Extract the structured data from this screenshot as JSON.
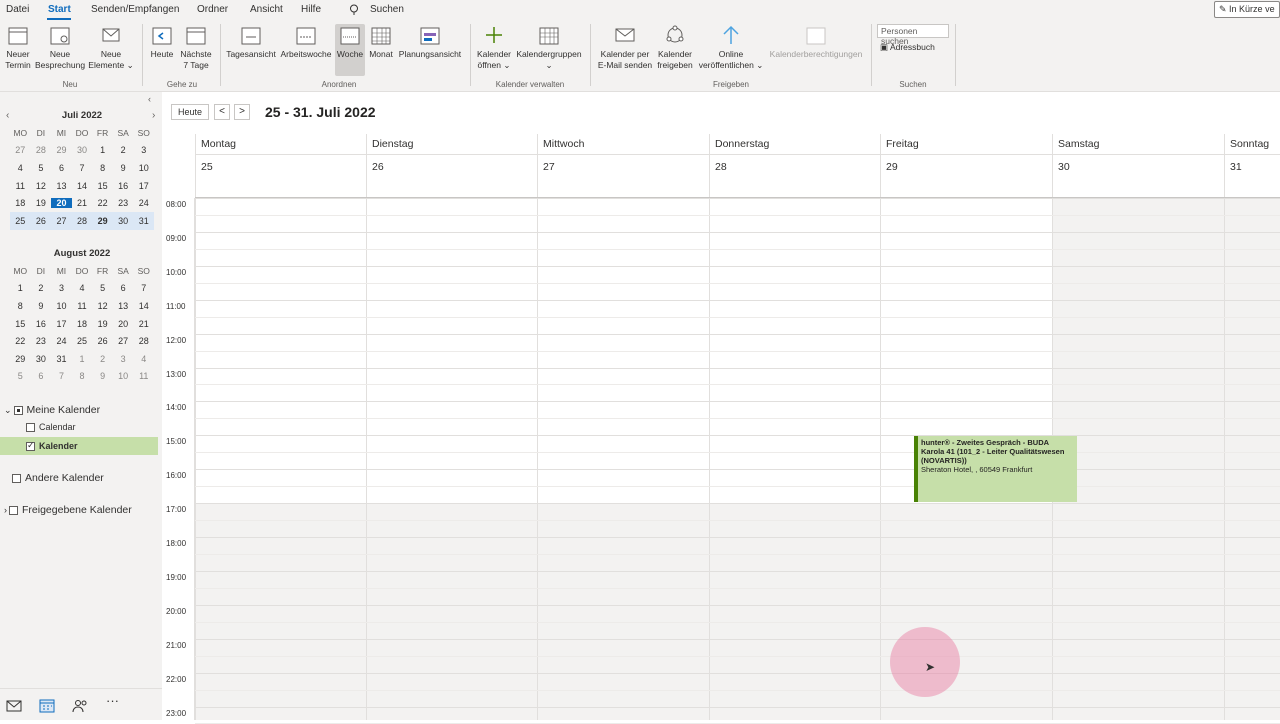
{
  "menu": {
    "items": [
      "Datei",
      "Start",
      "Senden/Empfangen",
      "Ordner",
      "Ansicht",
      "Hilfe",
      "Suchen"
    ],
    "soon_label": "In Kürze ve"
  },
  "ribbon": {
    "neu": {
      "termin": "Neuer Termin",
      "besprechung": "Neue Besprechung",
      "elemente": "Neue Elemente",
      "group": "Neu"
    },
    "gehezu": {
      "heute": "Heute",
      "naechste": "Nächste 7 Tage",
      "group": "Gehe zu"
    },
    "anordnen": {
      "tagesansicht": "Tagesansicht",
      "arbeitswoche": "Arbeitswoche",
      "woche": "Woche",
      "monat": "Monat",
      "planungsansicht": "Planungsansicht",
      "group": "Anordnen"
    },
    "verwalten": {
      "oeffnen": "Kalender öffnen",
      "gruppen": "Kalendergruppen",
      "group": "Kalender verwalten"
    },
    "freigeben": {
      "email": "Kalender per E-Mail senden",
      "freigeben": "Kalender freigeben",
      "online": "Online veröffentlichen",
      "berechtigungen": "Kalenderberechtigungen",
      "group": "Freigeben"
    },
    "suchen": {
      "placeholder": "Personen suchen",
      "adressbuch": "Adressbuch",
      "group": "Suchen"
    }
  },
  "mini_calendars": [
    {
      "title": "Juli 2022",
      "weekdays": [
        "MO",
        "DI",
        "MI",
        "DO",
        "FR",
        "SA",
        "SO"
      ],
      "weeks": [
        [
          "27",
          "28",
          "29",
          "30",
          "1",
          "2",
          "3"
        ],
        [
          "4",
          "5",
          "6",
          "7",
          "8",
          "9",
          "10"
        ],
        [
          "11",
          "12",
          "13",
          "14",
          "15",
          "16",
          "17"
        ],
        [
          "18",
          "19",
          "20",
          "21",
          "22",
          "23",
          "24"
        ],
        [
          "25",
          "26",
          "27",
          "28",
          "29",
          "30",
          "31"
        ]
      ],
      "today": "20",
      "selected_week_index": 4
    },
    {
      "title": "August 2022",
      "weekdays": [
        "MO",
        "DI",
        "MI",
        "DO",
        "FR",
        "SA",
        "SO"
      ],
      "weeks": [
        [
          "1",
          "2",
          "3",
          "4",
          "5",
          "6",
          "7"
        ],
        [
          "8",
          "9",
          "10",
          "11",
          "12",
          "13",
          "14"
        ],
        [
          "15",
          "16",
          "17",
          "18",
          "19",
          "20",
          "21"
        ],
        [
          "22",
          "23",
          "24",
          "25",
          "26",
          "27",
          "28"
        ],
        [
          "29",
          "30",
          "31",
          "1",
          "2",
          "3",
          "4"
        ],
        [
          "5",
          "6",
          "7",
          "8",
          "9",
          "10",
          "11"
        ]
      ]
    }
  ],
  "folders": {
    "meine": "Meine Kalender",
    "calendar": "Calendar",
    "kalender": "Kalender",
    "andere": "Andere Kalender",
    "freigegebene": "Freigegebene Kalender"
  },
  "calendar": {
    "today_button": "Heute",
    "prev": "<",
    "next": ">",
    "range": "25 - 31. Juli 2022",
    "days": [
      {
        "name": "Montag",
        "date": "25"
      },
      {
        "name": "Dienstag",
        "date": "26"
      },
      {
        "name": "Mittwoch",
        "date": "27"
      },
      {
        "name": "Donnerstag",
        "date": "28"
      },
      {
        "name": "Freitag",
        "date": "29"
      },
      {
        "name": "Samstag",
        "date": "30"
      },
      {
        "name": "Sonntag",
        "date": "31"
      }
    ],
    "hours": [
      "08:00",
      "09:00",
      "10:00",
      "11:00",
      "12:00",
      "13:00",
      "14:00",
      "15:00",
      "16:00",
      "17:00",
      "18:00",
      "19:00",
      "20:00",
      "21:00",
      "22:00",
      "23:00"
    ],
    "event": {
      "title": "hunter® - Zweites Gespräch - BUDA Karola 41 (101_2 - Leiter Qualitätswesen (NOVARTIS))",
      "location": "Sheraton Hotel, , 60549 Frankfurt",
      "color": "#c6dfa9",
      "accent": "#498205"
    }
  },
  "colors": {
    "accent": "#0f6cbd",
    "selection": "#c6dfa9"
  }
}
